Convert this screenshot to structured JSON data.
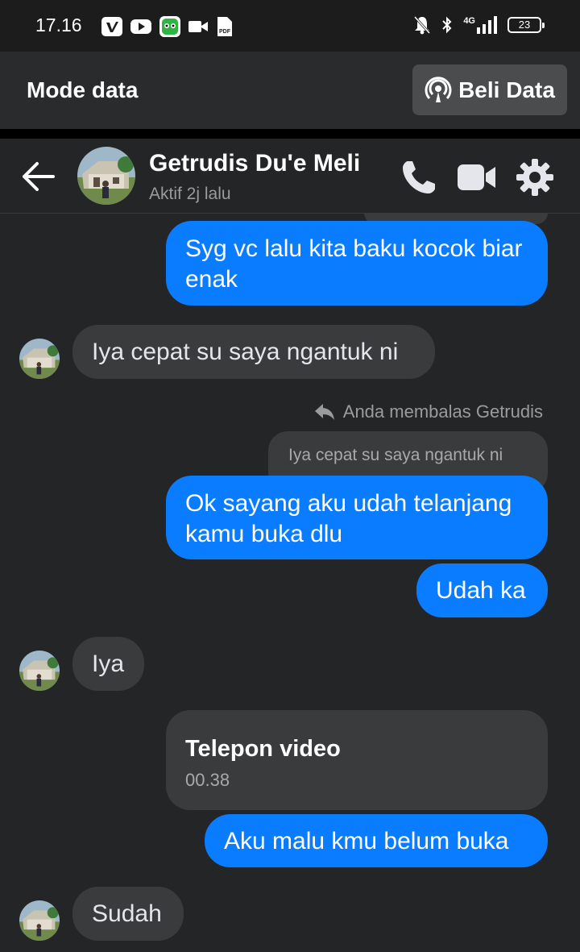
{
  "status_bar": {
    "time": "17.16",
    "battery": "23",
    "network": "4G"
  },
  "data_banner": {
    "label": "Mode data",
    "buy_button": "Beli Data"
  },
  "chat_header": {
    "name": "Getrudis Du'e Meli",
    "presence": "Aktif 2j lalu"
  },
  "messages": [
    {
      "type": "outgoing",
      "text": "Syg vc lalu kita baku kocok biar enak"
    },
    {
      "type": "incoming",
      "text": "Iya cepat su saya ngantuk ni"
    },
    {
      "type": "reply_note",
      "text": "Anda membalas Getrudis"
    },
    {
      "type": "quoted",
      "text": "Iya cepat su saya ngantuk ni"
    },
    {
      "type": "outgoing",
      "text": "Ok sayang aku udah telanjang kamu buka dlu"
    },
    {
      "type": "outgoing",
      "text": "Udah ka"
    },
    {
      "type": "incoming",
      "text": "Iya"
    },
    {
      "type": "call",
      "title": "Telepon video",
      "duration": "00.38"
    },
    {
      "type": "outgoing",
      "text": "Aku malu kmu belum buka"
    },
    {
      "type": "incoming",
      "text": "Sudah"
    }
  ],
  "colors": {
    "outgoing_bubble": "#0a7cff",
    "incoming_bubble": "#3a3b3c",
    "background": "#242526"
  }
}
